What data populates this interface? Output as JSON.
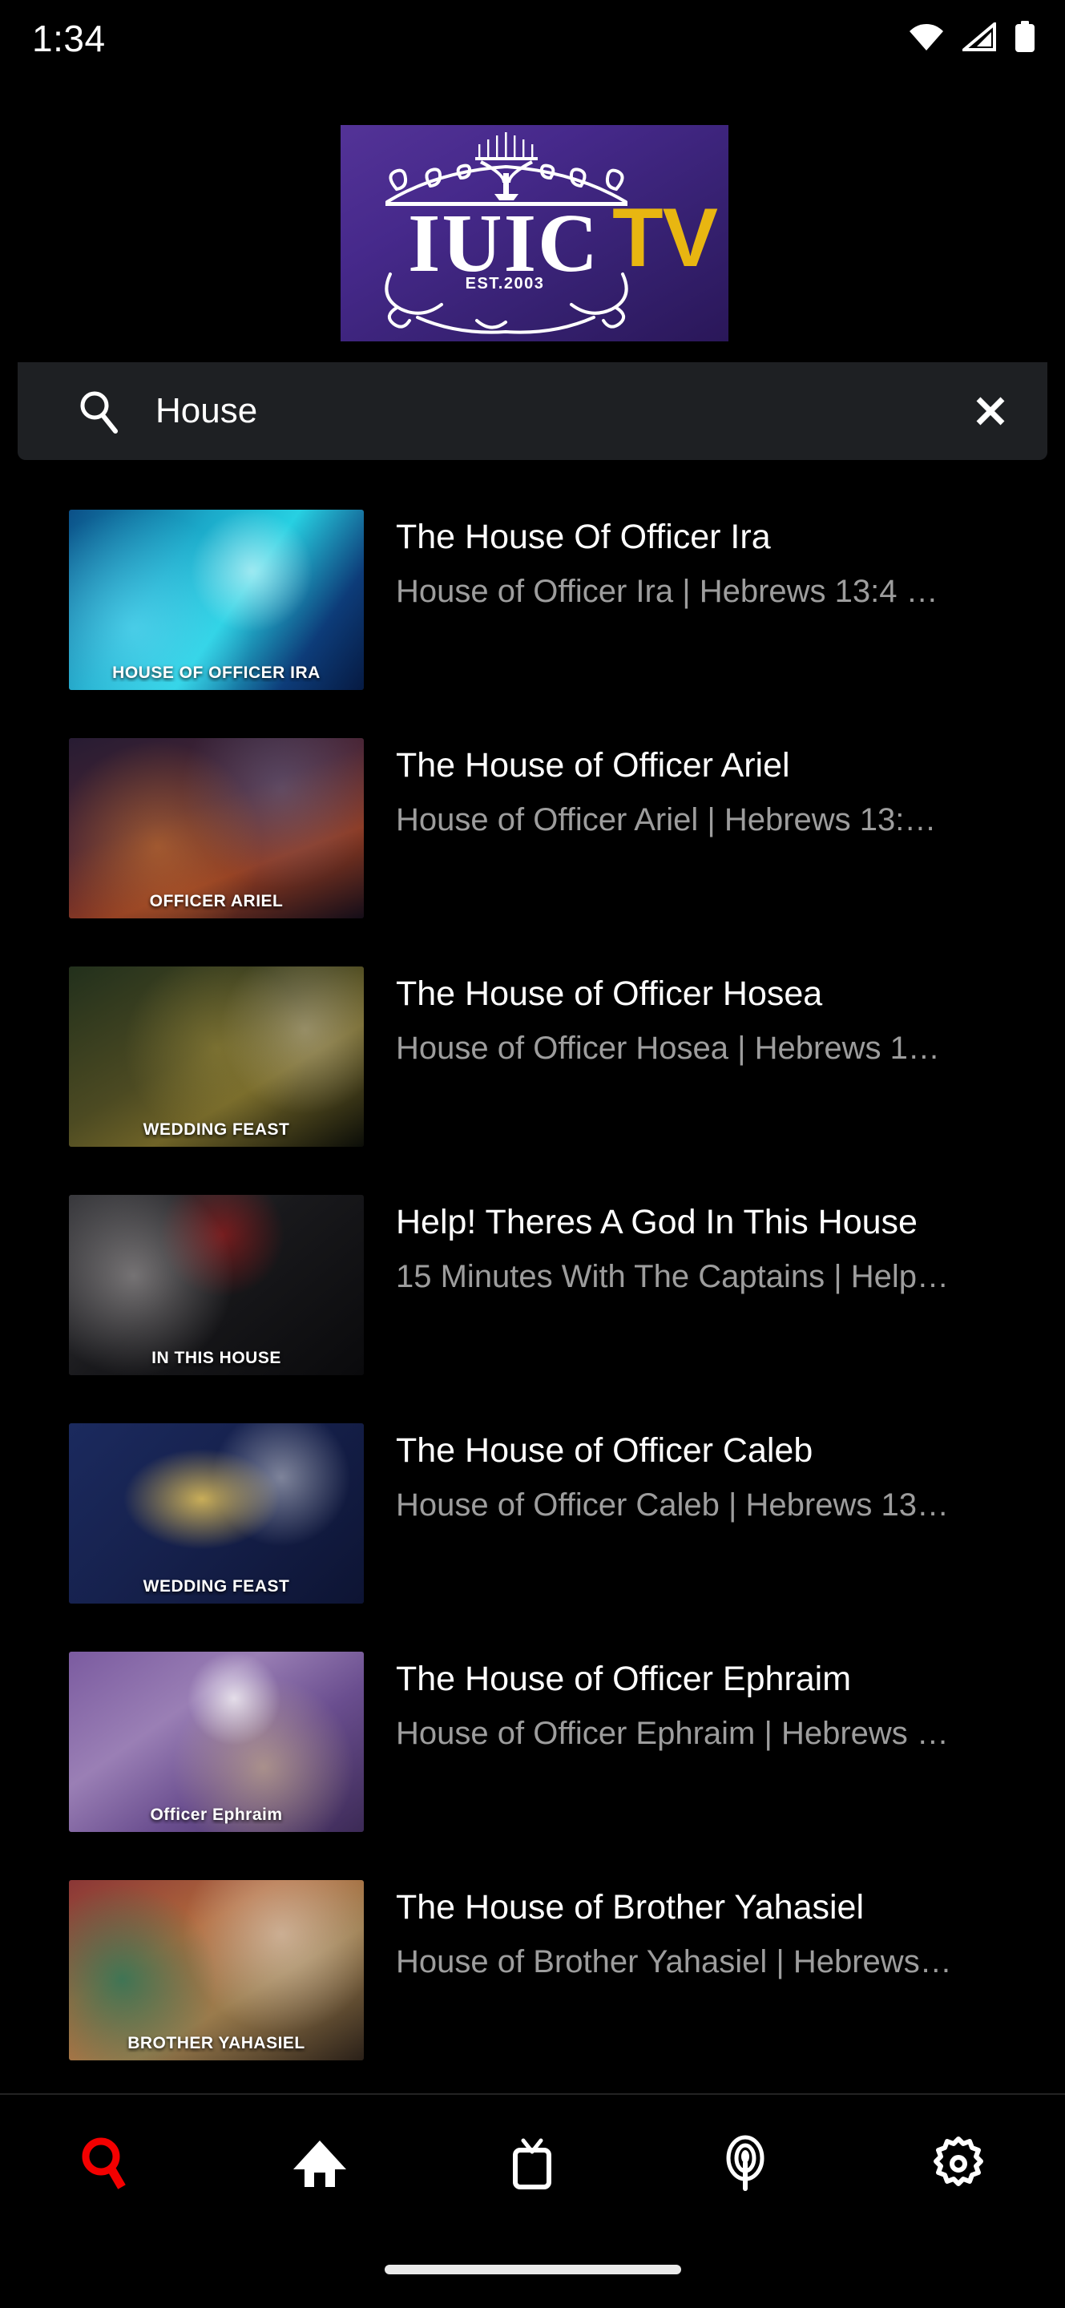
{
  "status_bar": {
    "time": "1:34",
    "icons": [
      "wifi-icon",
      "cellular-signal-icon",
      "battery-icon"
    ]
  },
  "header": {
    "logo": {
      "name": "iuic-tv-logo",
      "brand_text": "IUIC",
      "suffix_text": "TV",
      "established_text": "EST.2003",
      "gradient_from": "#533397",
      "gradient_to": "#2a1759",
      "accent_gold": "#e8b611"
    }
  },
  "search": {
    "value": "House",
    "placeholder": "Search",
    "search_icon": "search-icon",
    "clear_icon": "close-icon",
    "background": "#1e2023"
  },
  "results": [
    {
      "title": "The House Of Officer Ira",
      "subtitle": "House of Officer Ira | Hebrews 13:4 …",
      "thumb_label": "HOUSE OF OFFICER IRA",
      "thumb_c1": "#0f6fa8",
      "thumb_c2": "#2ecbe0",
      "thumb_c3": "#0a2f63"
    },
    {
      "title": "The House of Officer Ariel",
      "subtitle": "House of Officer Ariel | Hebrews 13:…",
      "thumb_label": "OFFICER ARIEL",
      "thumb_c1": "#2a1a2e",
      "thumb_c2": "#8d3a22",
      "thumb_c3": "#120d16"
    },
    {
      "title": "The House of Officer Hosea",
      "subtitle": "House of Officer Hosea | Hebrews 1…",
      "thumb_label": "WEDDING FEAST",
      "thumb_c1": "#1b2416",
      "thumb_c2": "#6f6327",
      "thumb_c3": "#0b0d08"
    },
    {
      "title": "Help! Theres A God In This House",
      "subtitle": "15 Minutes With The Captains | Help…",
      "thumb_label": "IN THIS HOUSE",
      "thumb_c1": "#2b2b2d",
      "thumb_c2": "#0a0a0c",
      "thumb_c3": "#3b3b40"
    },
    {
      "title": "The House of Officer Caleb",
      "subtitle": "House of Officer Caleb | Hebrews 13…",
      "thumb_label": "WEDDING FEAST",
      "thumb_c1": "#16214d",
      "thumb_c2": "#c79a2e",
      "thumb_c3": "#0d1433"
    },
    {
      "title": "The House of Officer Ephraim",
      "subtitle": "House of Officer Ephraim | Hebrews …",
      "thumb_label": "Officer Ephraim",
      "thumb_c1": "#6a4e8f",
      "thumb_c2": "#cbb07a",
      "thumb_c3": "#3c2a56"
    },
    {
      "title": "The House of Brother Yahasiel",
      "subtitle": "House of Brother Yahasiel | Hebrews…",
      "thumb_label": "BROTHER YAHASIEL",
      "thumb_c1": "#7a2d2d",
      "thumb_c2": "#cf9a4c",
      "thumb_c3": "#1d4338"
    }
  ],
  "bottom_nav": {
    "active_color": "#f40000",
    "inactive_color": "#ffffff",
    "items": [
      {
        "id": "search",
        "icon": "search-icon",
        "label": "Search",
        "active": true
      },
      {
        "id": "home",
        "icon": "home-icon",
        "label": "Home",
        "active": false
      },
      {
        "id": "tv",
        "icon": "tv-icon",
        "label": "TV",
        "active": false
      },
      {
        "id": "podcast",
        "icon": "podcast-icon",
        "label": "Podcast",
        "active": false
      },
      {
        "id": "settings",
        "icon": "gear-icon",
        "label": "Settings",
        "active": false
      }
    ]
  }
}
